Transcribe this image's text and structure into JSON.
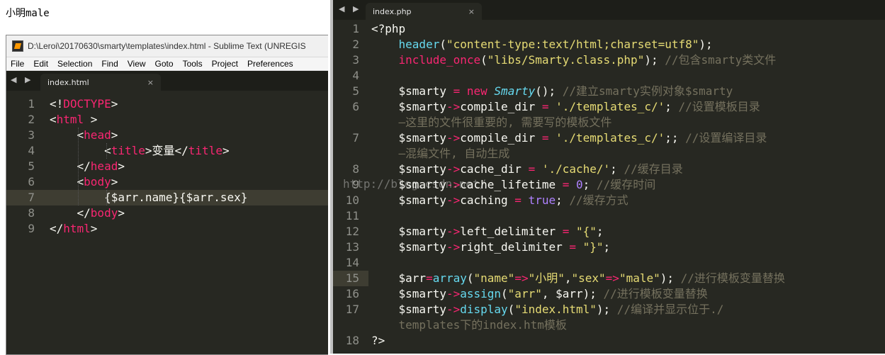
{
  "browser_output": {
    "text": "小明male"
  },
  "left_window": {
    "title": "D:\\Leroi\\20170630\\smarty\\templates\\index.html - Sublime Text (UNREGIS",
    "menu": [
      "File",
      "Edit",
      "Selection",
      "Find",
      "View",
      "Goto",
      "Tools",
      "Project",
      "Preferences"
    ],
    "tab": {
      "label": "index.html",
      "close": "×"
    },
    "nav": "◀ ▶",
    "lines": [
      {
        "n": "1",
        "parts": [
          [
            "p",
            "<!"
          ],
          [
            "t",
            "DOCTYPE"
          ],
          [
            "p",
            ">"
          ]
        ]
      },
      {
        "n": "2",
        "parts": [
          [
            "p",
            "<"
          ],
          [
            "t",
            "html"
          ],
          [
            "p",
            " >"
          ]
        ]
      },
      {
        "n": "3",
        "parts": [
          [
            "p",
            "    <"
          ],
          [
            "t",
            "head"
          ],
          [
            "p",
            ">"
          ]
        ]
      },
      {
        "n": "4",
        "parts": [
          [
            "p",
            "        <"
          ],
          [
            "t",
            "title"
          ],
          [
            "p",
            ">变量</"
          ],
          [
            "t",
            "title"
          ],
          [
            "p",
            ">"
          ]
        ]
      },
      {
        "n": "5",
        "parts": [
          [
            "p",
            "    </"
          ],
          [
            "t",
            "head"
          ],
          [
            "p",
            ">"
          ]
        ]
      },
      {
        "n": "6",
        "parts": [
          [
            "p",
            "    <"
          ],
          [
            "t",
            "body"
          ],
          [
            "p",
            ">"
          ]
        ]
      },
      {
        "n": "7",
        "parts": [
          [
            "p",
            "        {$arr.name}{$arr.sex}"
          ]
        ]
      },
      {
        "n": "8",
        "parts": [
          [
            "p",
            "    </"
          ],
          [
            "t",
            "body"
          ],
          [
            "p",
            ">"
          ]
        ]
      },
      {
        "n": "9",
        "parts": [
          [
            "p",
            "</"
          ],
          [
            "t",
            "html"
          ],
          [
            "p",
            ">"
          ]
        ]
      }
    ]
  },
  "right_window": {
    "tab": {
      "label": "index.php",
      "close": "×"
    },
    "nav": "◀ ▶",
    "watermark": "http://blog.csdn.net/",
    "lines": [
      {
        "n": "1",
        "parts": [
          [
            "p",
            "<?php"
          ]
        ]
      },
      {
        "n": "2",
        "parts": [
          [
            "p",
            "    "
          ],
          [
            "f",
            "header"
          ],
          [
            "p",
            "("
          ],
          [
            "s",
            "\"content-type:text/html;charset=utf8\""
          ],
          [
            "p",
            ");"
          ]
        ]
      },
      {
        "n": "3",
        "parts": [
          [
            "p",
            "    "
          ],
          [
            "k",
            "include_once"
          ],
          [
            "p",
            "("
          ],
          [
            "s",
            "\"libs/Smarty.class.php\""
          ],
          [
            "p",
            ");"
          ],
          [
            "c",
            " //包含smarty类文件"
          ]
        ]
      },
      {
        "n": "4",
        "parts": []
      },
      {
        "n": "5",
        "parts": [
          [
            "p",
            "    $smarty "
          ],
          [
            "k",
            "="
          ],
          [
            "p",
            " "
          ],
          [
            "k",
            "new"
          ],
          [
            "p",
            " "
          ],
          [
            "l",
            "Smarty"
          ],
          [
            "p",
            "();"
          ],
          [
            "c",
            " //建立smarty实例对象$smarty"
          ]
        ]
      },
      {
        "n": "6",
        "parts": [
          [
            "p",
            "    $smarty"
          ],
          [
            "k",
            "->"
          ],
          [
            "p",
            "compile_dir "
          ],
          [
            "k",
            "="
          ],
          [
            "p",
            " "
          ],
          [
            "s",
            "'./templates_c/'"
          ],
          [
            "p",
            ";"
          ],
          [
            "c",
            " //设置模板目录"
          ]
        ]
      },
      {
        "n": "",
        "parts": [
          [
            "c",
            "    —这里的文件很重要的, 需要写的模板文件"
          ]
        ]
      },
      {
        "n": "7",
        "parts": [
          [
            "p",
            "    $smarty"
          ],
          [
            "k",
            "->"
          ],
          [
            "p",
            "compile_dir "
          ],
          [
            "k",
            "="
          ],
          [
            "p",
            " "
          ],
          [
            "s",
            "'./templates_c/'"
          ],
          [
            "p",
            ";;"
          ],
          [
            "c",
            " //设置编译目录"
          ]
        ]
      },
      {
        "n": "",
        "parts": [
          [
            "c",
            "    —混编文件, 自动生成"
          ]
        ]
      },
      {
        "n": "8",
        "parts": [
          [
            "p",
            "    $smarty"
          ],
          [
            "k",
            "->"
          ],
          [
            "p",
            "cache_dir "
          ],
          [
            "k",
            "="
          ],
          [
            "p",
            " "
          ],
          [
            "s",
            "'./cache/'"
          ],
          [
            "p",
            ";"
          ],
          [
            "c",
            " //缓存目录"
          ]
        ]
      },
      {
        "n": "9",
        "parts": [
          [
            "p",
            "    $smarty"
          ],
          [
            "k",
            "->"
          ],
          [
            "p",
            "cache_lifetime "
          ],
          [
            "k",
            "="
          ],
          [
            "p",
            " "
          ],
          [
            "n",
            "0"
          ],
          [
            "p",
            ";"
          ],
          [
            "c",
            " //缓存时间"
          ]
        ]
      },
      {
        "n": "10",
        "parts": [
          [
            "p",
            "    $smarty"
          ],
          [
            "k",
            "->"
          ],
          [
            "p",
            "caching "
          ],
          [
            "k",
            "="
          ],
          [
            "p",
            " "
          ],
          [
            "n",
            "true"
          ],
          [
            "p",
            ";"
          ],
          [
            "c",
            " //缓存方式"
          ]
        ]
      },
      {
        "n": "11",
        "parts": []
      },
      {
        "n": "12",
        "parts": [
          [
            "p",
            "    $smarty"
          ],
          [
            "k",
            "->"
          ],
          [
            "p",
            "left_delimiter "
          ],
          [
            "k",
            "="
          ],
          [
            "p",
            " "
          ],
          [
            "s",
            "\"{\""
          ],
          [
            "p",
            ";"
          ]
        ]
      },
      {
        "n": "13",
        "parts": [
          [
            "p",
            "    $smarty"
          ],
          [
            "k",
            "->"
          ],
          [
            "p",
            "right_delimiter "
          ],
          [
            "k",
            "="
          ],
          [
            "p",
            " "
          ],
          [
            "s",
            "\"}\""
          ],
          [
            "p",
            ";"
          ]
        ]
      },
      {
        "n": "14",
        "parts": []
      },
      {
        "n": "15",
        "parts": [
          [
            "p",
            "    $arr"
          ],
          [
            "k",
            "="
          ],
          [
            "f",
            "array"
          ],
          [
            "p",
            "("
          ],
          [
            "s",
            "\"name\""
          ],
          [
            "k",
            "=>"
          ],
          [
            "s",
            "\"小明\""
          ],
          [
            "p",
            ","
          ],
          [
            "s",
            "\"sex\""
          ],
          [
            "k",
            "=>"
          ],
          [
            "s",
            "\"male\""
          ],
          [
            "p",
            ");"
          ],
          [
            "c",
            " //进行模板变量替换"
          ]
        ]
      },
      {
        "n": "16",
        "parts": [
          [
            "p",
            "    $smarty"
          ],
          [
            "k",
            "->"
          ],
          [
            "f",
            "assign"
          ],
          [
            "p",
            "("
          ],
          [
            "s",
            "\"arr\""
          ],
          [
            "p",
            ", $arr);"
          ],
          [
            "c",
            " //进行模板变量替换"
          ]
        ]
      },
      {
        "n": "17",
        "parts": [
          [
            "p",
            "    $smarty"
          ],
          [
            "k",
            "->"
          ],
          [
            "f",
            "display"
          ],
          [
            "p",
            "("
          ],
          [
            "s",
            "\"index.html\""
          ],
          [
            "p",
            ");"
          ],
          [
            "c",
            " //编译并显示位于./"
          ]
        ]
      },
      {
        "n": "",
        "parts": [
          [
            "c",
            "    templates下的index.htm模板"
          ]
        ]
      },
      {
        "n": "18",
        "parts": [
          [
            "p",
            "?>"
          ]
        ]
      }
    ]
  },
  "colors": {
    "editor_bg": "#272822",
    "tag": "#f92672",
    "string": "#e6db74",
    "function": "#66d9ef",
    "comment": "#75715e",
    "number": "#ae81ff"
  }
}
